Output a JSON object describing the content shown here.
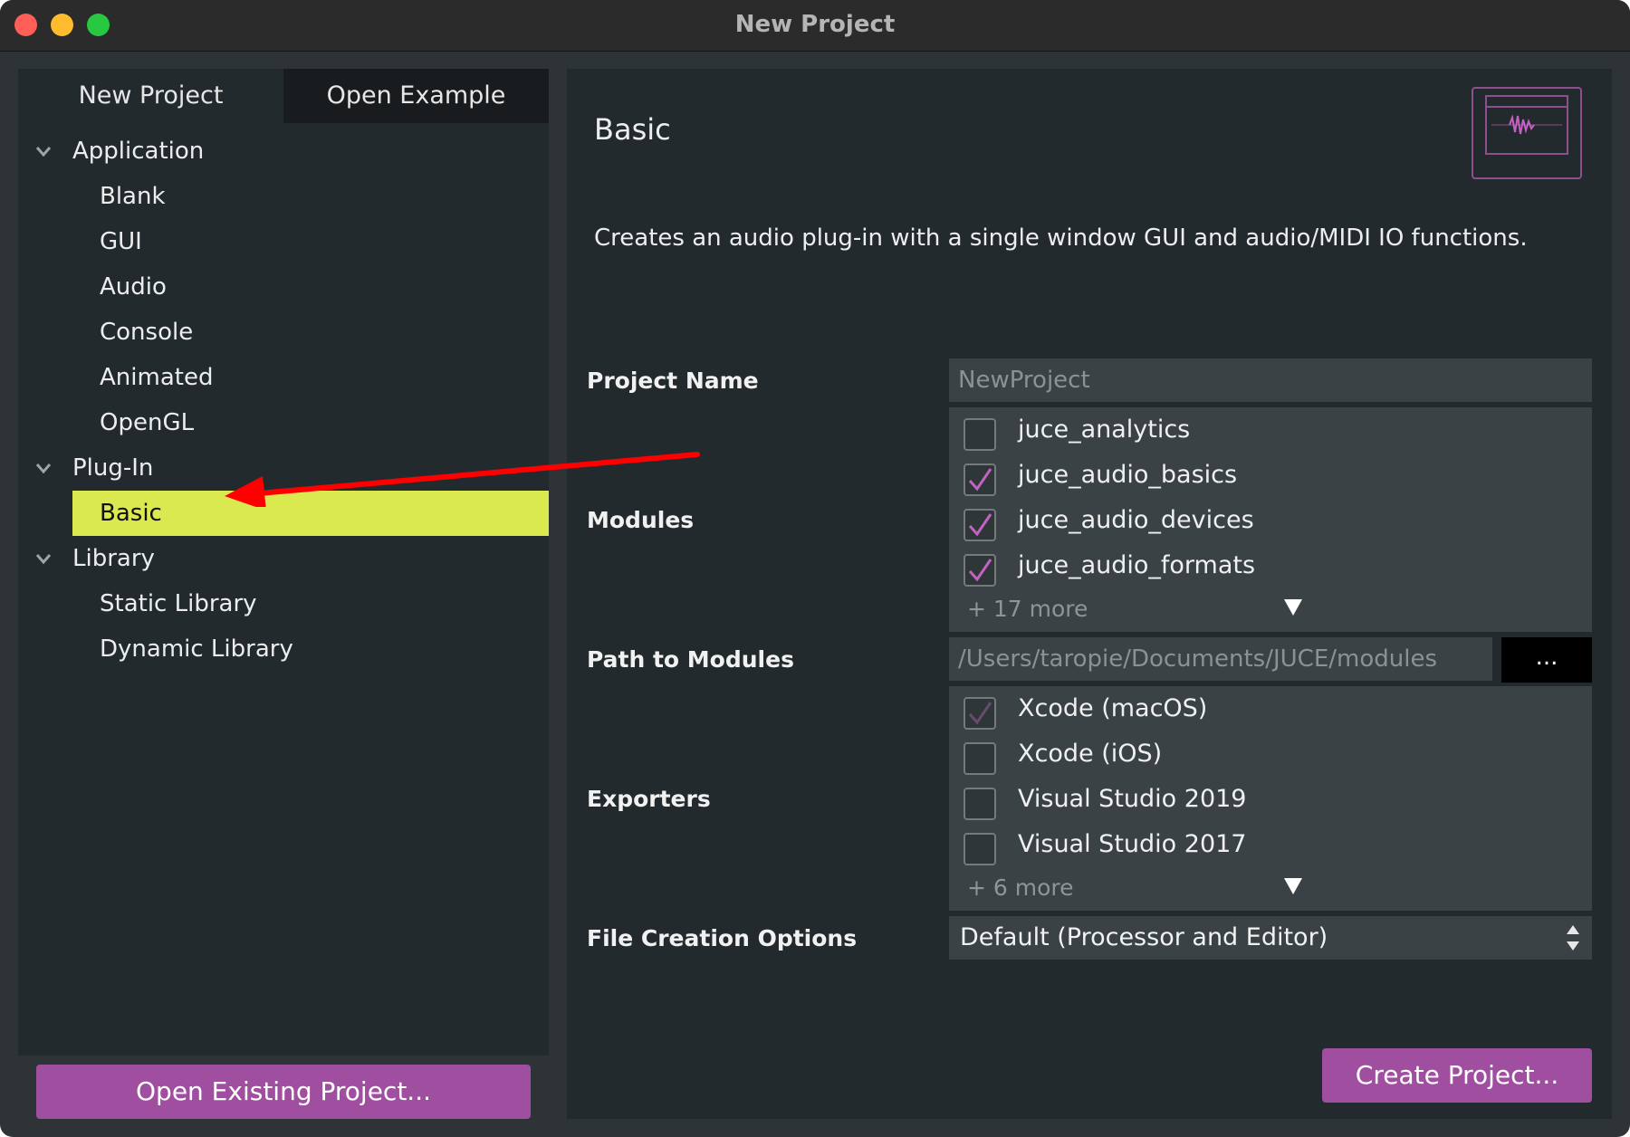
{
  "window": {
    "title": "New Project"
  },
  "tabs": {
    "new_project": "New Project",
    "open_example": "Open Example"
  },
  "tree": {
    "application": {
      "label": "Application",
      "items": [
        "Blank",
        "GUI",
        "Audio",
        "Console",
        "Animated",
        "OpenGL"
      ]
    },
    "plugin": {
      "label": "Plug-In",
      "items": [
        "Basic"
      ]
    },
    "library": {
      "label": "Library",
      "items": [
        "Static Library",
        "Dynamic Library"
      ]
    },
    "selected": "Basic"
  },
  "buttons": {
    "open_existing": "Open Existing Project...",
    "create_project": "Create Project...",
    "browse": "..."
  },
  "detail": {
    "heading": "Basic",
    "description": "Creates an audio plug-in with a single window GUI and audio/MIDI IO functions."
  },
  "form": {
    "project_name_label": "Project Name",
    "project_name_placeholder": "NewProject",
    "modules_label": "Modules",
    "modules": [
      {
        "name": "juce_analytics",
        "checked": false
      },
      {
        "name": "juce_audio_basics",
        "checked": true
      },
      {
        "name": "juce_audio_devices",
        "checked": true
      },
      {
        "name": "juce_audio_formats",
        "checked": true
      }
    ],
    "modules_more": "+ 17 more",
    "path_label": "Path to Modules",
    "path_value": "/Users/taropie/Documents/JUCE/modules",
    "exporters_label": "Exporters",
    "exporters": [
      {
        "name": "Xcode (macOS)",
        "checked": true
      },
      {
        "name": "Xcode (iOS)",
        "checked": false
      },
      {
        "name": "Visual Studio 2019",
        "checked": false
      },
      {
        "name": "Visual Studio 2017",
        "checked": false
      }
    ],
    "exporters_more": "+ 6 more",
    "file_options_label": "File Creation Options",
    "file_options_value": "Default (Processor and Editor)"
  },
  "colors": {
    "accent": "#a04fa0",
    "selected_bg": "#dbe951",
    "checkmark": "#c462c4",
    "annotation": "#ff0000"
  },
  "icons": {
    "expand": "chevron-down-icon",
    "check": "checkmark-icon",
    "more": "triangle-down-icon",
    "select": "up-down-arrows-icon",
    "thumbnail": "plugin-thumbnail-icon"
  }
}
